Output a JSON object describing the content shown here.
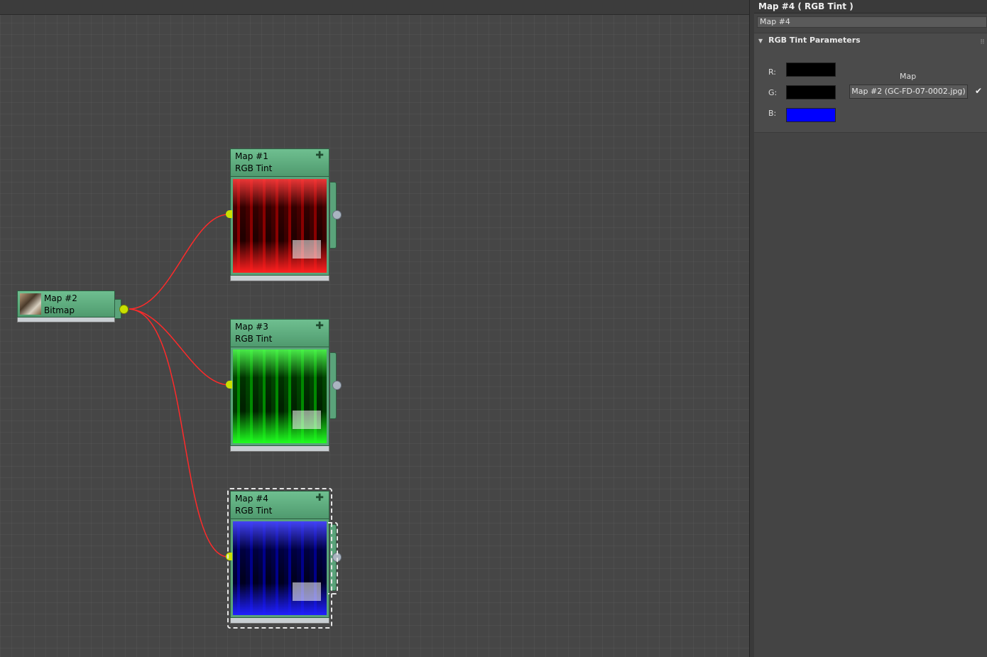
{
  "panel": {
    "title": "Map #4  ( RGB Tint )",
    "name_value": "Map #4",
    "rollout_title": "RGB Tint Parameters",
    "r_label": "R:",
    "g_label": "G:",
    "b_label": "B:",
    "r_color": "#000000",
    "g_color": "#000000",
    "b_color": "#0000ff",
    "map_heading": "Map",
    "map_button": "Map #2 (GC-FD-07-0002.jpg)",
    "map_enabled": true
  },
  "nodes": {
    "map1": {
      "name": "Map #1",
      "type": "RGB Tint",
      "tint": "#ff0000"
    },
    "map3": {
      "name": "Map #3",
      "type": "RGB Tint",
      "tint": "#00ff00"
    },
    "map4": {
      "name": "Map #4",
      "type": "RGB Tint",
      "tint": "#0000ff",
      "selected": true
    },
    "map2": {
      "name": "Map #2",
      "type": "Bitmap"
    }
  },
  "colors": {
    "wire": "#ff2a2a",
    "node_header": "#5fae80",
    "socket_in": "#c9e000"
  }
}
